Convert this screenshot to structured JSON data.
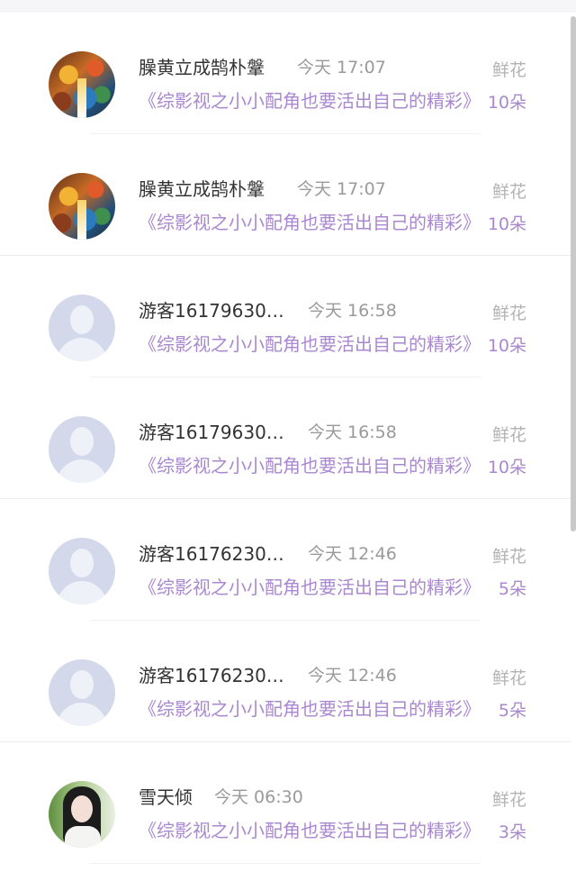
{
  "gift_label": "鲜花",
  "records": [
    {
      "avatar": "painting-avatar",
      "name": "臊黄立成鹄朴鞶",
      "time": "今天 17:07",
      "book": "《综影视之小小配角也要活出自己的精彩》",
      "count": "10朵"
    },
    {
      "avatar": "painting-avatar",
      "name": "臊黄立成鹄朴鞶",
      "time": "今天 17:07",
      "book": "《综影视之小小配角也要活出自己的精彩》",
      "count": "10朵"
    },
    {
      "avatar": "guest-avatar",
      "name": "游客16179630…",
      "time": "今天 16:58",
      "book": "《综影视之小小配角也要活出自己的精彩》",
      "count": "10朵"
    },
    {
      "avatar": "guest-avatar",
      "name": "游客16179630…",
      "time": "今天 16:58",
      "book": "《综影视之小小配角也要活出自己的精彩》",
      "count": "10朵"
    },
    {
      "avatar": "guest-avatar",
      "name": "游客16176230…",
      "time": "今天 12:46",
      "book": "《综影视之小小配角也要活出自己的精彩》",
      "count": "5朵"
    },
    {
      "avatar": "guest-avatar",
      "name": "游客16176230…",
      "time": "今天 12:46",
      "book": "《综影视之小小配角也要活出自己的精彩》",
      "count": "5朵"
    },
    {
      "avatar": "portrait-avatar",
      "name": "雪天倾",
      "time": "今天 06:30",
      "book": "《综影视之小小配角也要活出自己的精彩》",
      "count": "3朵"
    }
  ],
  "colors": {
    "accent": "#a988cf",
    "name": "#333333",
    "muted": "#9a9a9a"
  }
}
